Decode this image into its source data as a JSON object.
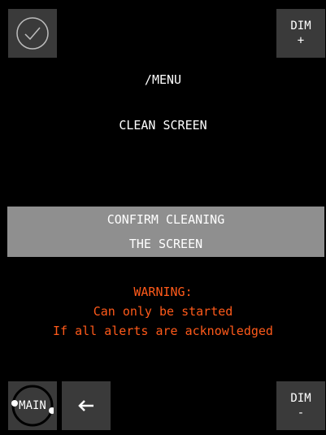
{
  "header": {
    "ack_icon": "check-circle-icon",
    "dim_plus": {
      "line1": "DIM",
      "line2": "+"
    }
  },
  "main": {
    "breadcrumb": "/MENU",
    "title": "CLEAN SCREEN",
    "confirm": {
      "line1": "CONFIRM CLEANING",
      "line2": "THE SCREEN"
    },
    "warning": {
      "heading": "WARNING:",
      "line1": "Can only be started",
      "line2": "If all alerts are acknowledged"
    }
  },
  "footer": {
    "main_label": "MAIN",
    "back_icon": "arrow-left-icon",
    "dim_minus": {
      "line1": "DIM",
      "line2": "-"
    }
  },
  "colors": {
    "background": "#000000",
    "tile": "#3a3a3a",
    "confirm_bg": "#8f8f8f",
    "warning": "#ff5a1a"
  }
}
